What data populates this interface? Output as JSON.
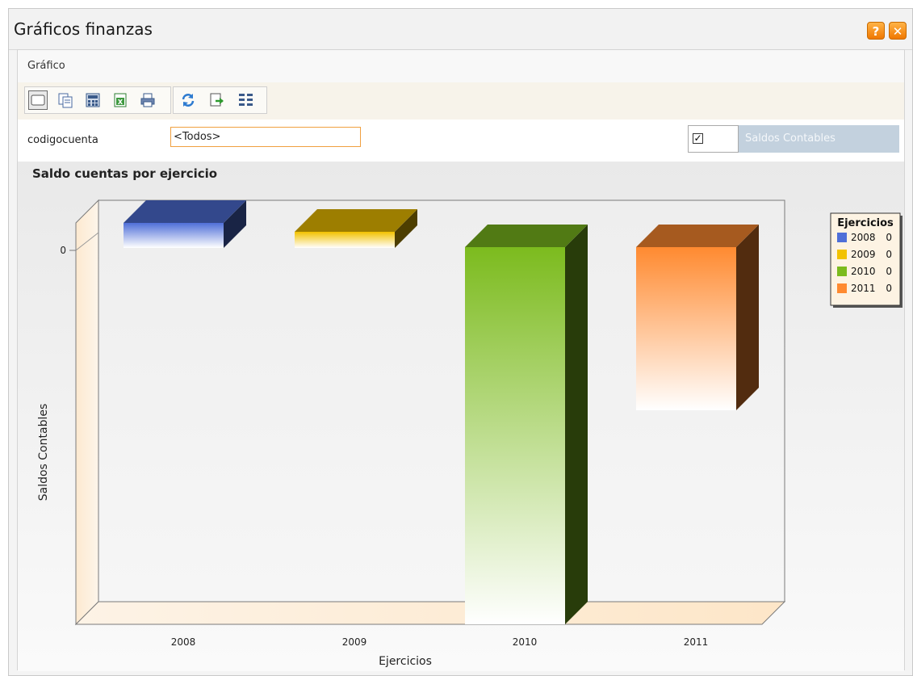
{
  "window": {
    "title": "Gráficos finanzas",
    "help_label": "?",
    "close_label": "✕"
  },
  "menu": {
    "items": [
      {
        "label": "Gráfico"
      }
    ]
  },
  "toolbar": {
    "icons": [
      "chart-view-icon",
      "copy-icon",
      "calculator-icon",
      "excel-export-icon",
      "print-icon",
      "refresh-icon",
      "export-icon",
      "settings-icon"
    ]
  },
  "filter": {
    "label": "codigocuenta",
    "value": "<Todos>",
    "checkbox_checked": true,
    "checkbox_mark": "✓",
    "toggle_label": "Saldos Contables"
  },
  "chart_data": {
    "type": "bar",
    "title": "Saldo cuentas por ejercicio",
    "xlabel": "Ejercicios",
    "ylabel": "Saldos Contables",
    "categories": [
      "2008",
      "2009",
      "2010",
      "2011"
    ],
    "series": [
      {
        "name": "2008",
        "values": [
          0
        ],
        "color": "#4f6fd8"
      },
      {
        "name": "2009",
        "values": [
          0
        ],
        "color": "#f2c200"
      },
      {
        "name": "2010",
        "values": [
          0
        ],
        "color": "#7cbb1e"
      },
      {
        "name": "2011",
        "values": [
          0
        ],
        "color": "#ff8a30"
      }
    ],
    "yticks": [
      "0"
    ],
    "legend": {
      "title": "Ejercicios",
      "position": "top-right",
      "entries": [
        {
          "label": "2008",
          "value": "0"
        },
        {
          "label": "2009",
          "value": "0"
        },
        {
          "label": "2010",
          "value": "0"
        },
        {
          "label": "2011",
          "value": "0"
        }
      ]
    },
    "view": "3d"
  }
}
